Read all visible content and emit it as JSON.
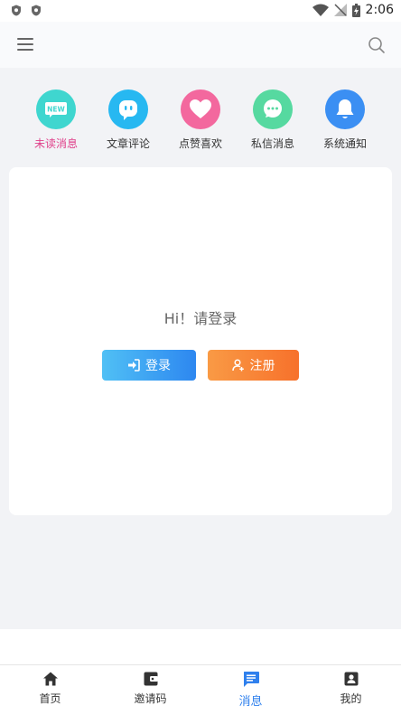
{
  "status_bar": {
    "time": "2:06"
  },
  "header": {
    "menu_icon": "menu-icon",
    "search_icon": "search-icon"
  },
  "categories": [
    {
      "label": "未读消息",
      "icon": "new-badge-icon",
      "color": "#3fd6cf",
      "active": true
    },
    {
      "label": "文章评论",
      "icon": "comment-bubble-icon",
      "color": "#27b8f1",
      "active": false
    },
    {
      "label": "点赞喜欢",
      "icon": "heart-icon",
      "color": "#f3689e",
      "active": false
    },
    {
      "label": "私信消息",
      "icon": "chat-icon",
      "color": "#56d9a0",
      "active": false
    },
    {
      "label": "系统通知",
      "icon": "bell-icon",
      "color": "#3b8ff3",
      "active": false
    }
  ],
  "login_card": {
    "greeting": "Hi！请登录",
    "login_label": "登录",
    "register_label": "注册"
  },
  "bottom_nav": [
    {
      "label": "首页",
      "icon": "home-icon",
      "active": false
    },
    {
      "label": "邀请码",
      "icon": "wallet-icon",
      "active": false
    },
    {
      "label": "消息",
      "icon": "message-icon",
      "active": true
    },
    {
      "label": "我的",
      "icon": "profile-icon",
      "active": false
    }
  ],
  "colors": {
    "active_nav": "#2f80ed",
    "active_category": "#e0408a"
  }
}
